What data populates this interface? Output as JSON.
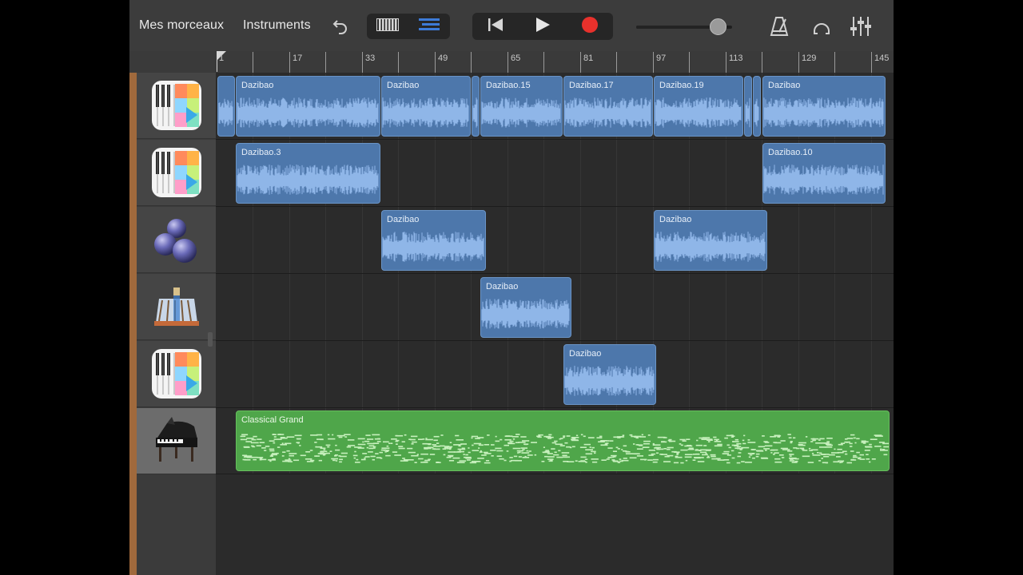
{
  "toolbar": {
    "my_songs": "Mes morceaux",
    "instruments": "Instruments"
  },
  "ruler": {
    "bar_labels": [
      "1",
      "17",
      "33",
      "49",
      "65",
      "81",
      "97",
      "113",
      "129",
      "145"
    ]
  },
  "tracks": [
    {
      "icon": "keyboard-app-icon"
    },
    {
      "icon": "keyboard-app-icon"
    },
    {
      "icon": "drum-sphere-icon"
    },
    {
      "icon": "smart-strings-icon"
    },
    {
      "icon": "keyboard-app-icon"
    },
    {
      "icon": "grand-piano-icon"
    }
  ],
  "regions": {
    "r1a": "Dazibao",
    "r1b": "Dazibao",
    "r1c": "Dazibao.15",
    "r1d": "Dazibao.17",
    "r1e": "Dazibao.19",
    "r1f": "Dazibao",
    "r2a": "Dazibao.3",
    "r2b": "Dazibao.10",
    "r3a": "Dazibao",
    "r3b": "Dazibao",
    "r4a": "Dazibao",
    "r5a": "Dazibao",
    "r6a": "Classical Grand"
  },
  "colors": {
    "audio_region": "#4d77ab",
    "midi_region": "#4fa64a",
    "record": "#e8312c",
    "active_view": "#3d7bd8"
  }
}
